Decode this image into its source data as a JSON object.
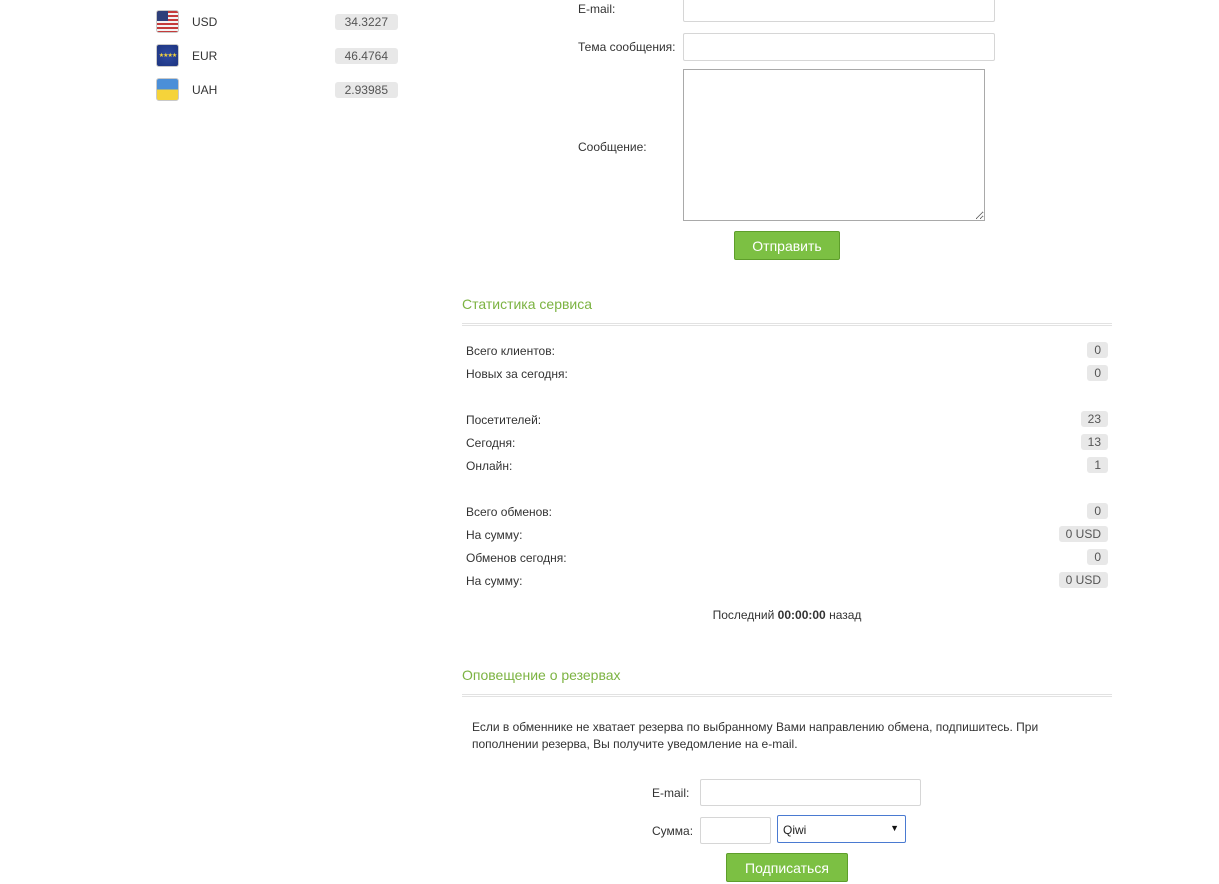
{
  "currencies": [
    {
      "code": "USD",
      "rate": "34.3227",
      "flag_icon": "us-flag-icon"
    },
    {
      "code": "EUR",
      "rate": "46.4764",
      "flag_icon": "eu-flag-icon"
    },
    {
      "code": "UAH",
      "rate": "2.93985",
      "flag_icon": "ua-flag-icon"
    }
  ],
  "feedback": {
    "email_label": "E-mail:",
    "subject_label": "Тема сообщения:",
    "message_label": "Сообщение:",
    "send_button": "Отправить"
  },
  "stats": {
    "title": "Статистика сервиса",
    "total_clients_label": "Всего клиентов:",
    "total_clients": "0",
    "new_today_label": "Новых за сегодня:",
    "new_today": "0",
    "visitors_label": "Посетителей:",
    "visitors": "23",
    "today_label": "Сегодня:",
    "today": "13",
    "online_label": "Онлайн:",
    "online": "1",
    "total_exchanges_label": "Всего обменов:",
    "total_exchanges": "0",
    "total_sum_label": "На сумму:",
    "total_sum": "0 USD",
    "exchanges_today_label": "Обменов сегодня:",
    "exchanges_today": "0",
    "today_sum_label": "На сумму:",
    "today_sum": "0 USD",
    "last_prefix": "Последний",
    "last_time": "00:00:00",
    "last_suffix": "назад"
  },
  "reserve": {
    "title": "Оповещение о резервах",
    "notice": "Если в обменнике не хватает резерва по выбранному Вами направлению обмена, подпишитесь. При пополнении резерва, Вы получите уведомление на e-mail.",
    "email_label": "E-mail:",
    "amount_label": "Сумма:",
    "currency_selected": "Qiwi",
    "subscribe_button": "Подписаться"
  },
  "colors": {
    "accent_green": "#7cb342",
    "button_green": "#7cc043"
  }
}
